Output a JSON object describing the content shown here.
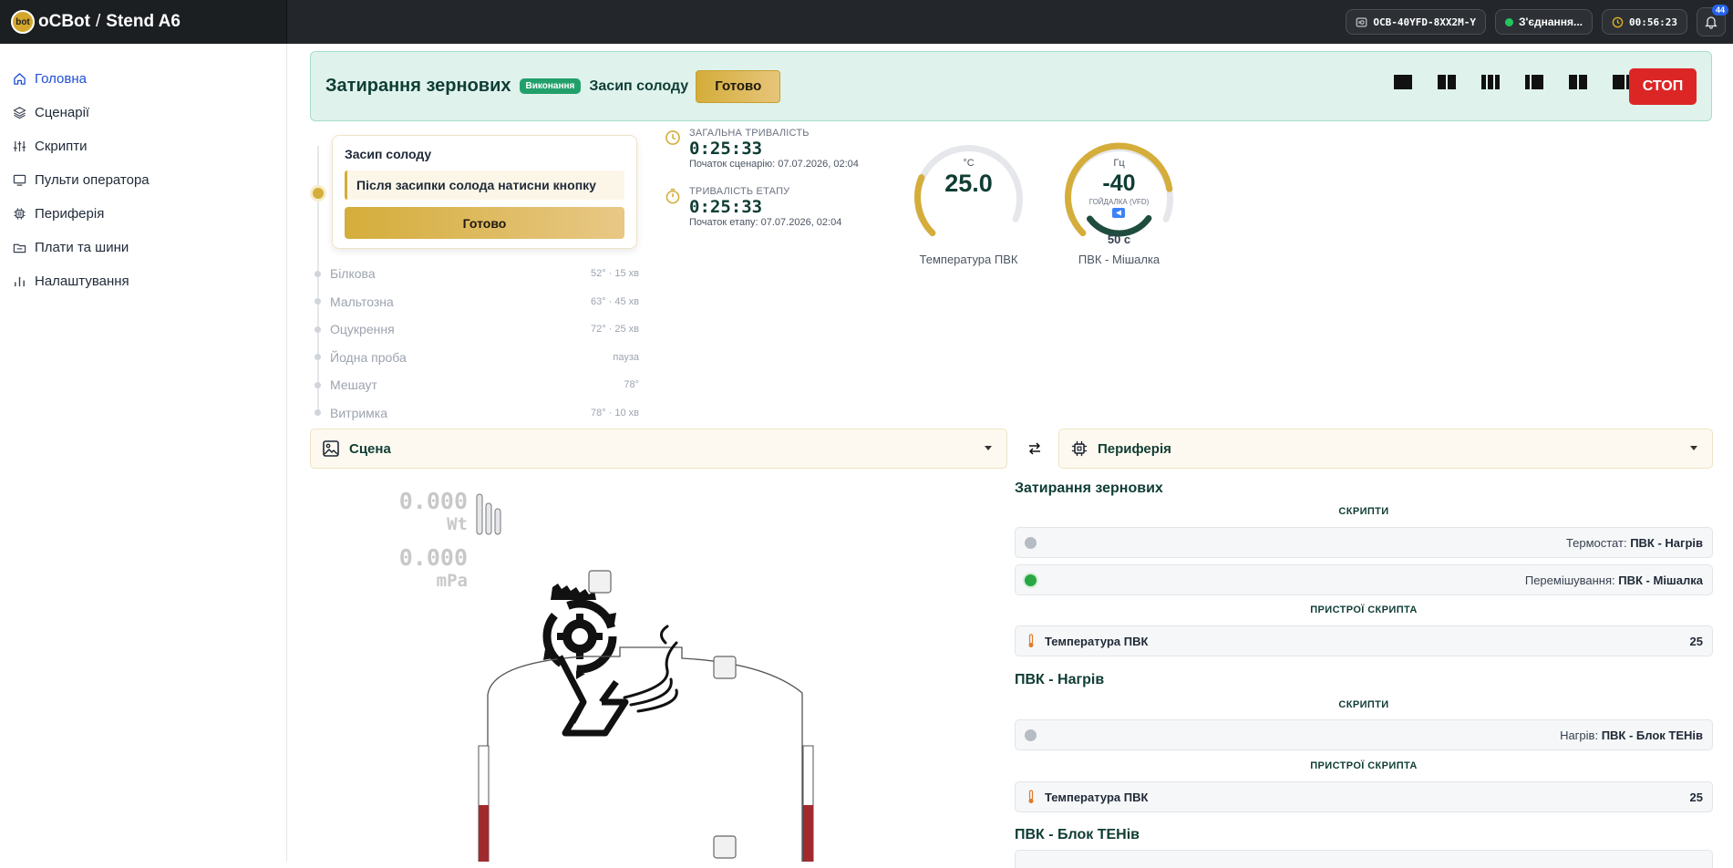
{
  "header": {
    "brand_name": "oCBot",
    "logo_text": "bot",
    "separator": "/",
    "stand": "Stend A6",
    "device_id": "OCB-40YFD-8XX2M-Y",
    "connection": "З'єднання...",
    "timer": "00:56:23",
    "notifications": "44"
  },
  "sidebar": {
    "items": [
      {
        "label": "Головна",
        "icon": "home-icon"
      },
      {
        "label": "Сценарії",
        "icon": "layers-icon"
      },
      {
        "label": "Скрипти",
        "icon": "sliders-icon"
      },
      {
        "label": "Пульти оператора",
        "icon": "monitor-icon"
      },
      {
        "label": "Периферія",
        "icon": "chip-icon"
      },
      {
        "label": "Плати та шини",
        "icon": "board-icon"
      },
      {
        "label": "Налаштування",
        "icon": "bars-icon"
      }
    ]
  },
  "banner": {
    "title": "Затирання зернових",
    "status": "Виконання",
    "step": "Засип солоду",
    "ready_label": "Готово",
    "stop_label": "СТОП"
  },
  "step_card": {
    "title": "Засип солоду",
    "message": "Після засипки солода натисни кнопку",
    "button": "Готово"
  },
  "steps": [
    {
      "name": "Білкова",
      "value": "52° · 15 хв"
    },
    {
      "name": "Мальтозна",
      "value": "63° · 45 хв"
    },
    {
      "name": "Оцукрення",
      "value": "72° · 25 хв"
    },
    {
      "name": "Йодна проба",
      "value": "пауза"
    },
    {
      "name": "Мешаут",
      "value": "78°"
    },
    {
      "name": "Витримка",
      "value": "78° · 10 хв"
    }
  ],
  "durations": {
    "total_label": "ЗАГАЛЬНА ТРИВАЛІСТЬ",
    "total_value": "0:25:33",
    "total_sub": "Початок сценарію: 07.07.2026, 02:04",
    "stage_label": "ТРИВАЛІСТЬ ЕТАПУ",
    "stage_value": "0:25:33",
    "stage_sub": "Початок етапу: 07.07.2026, 02:04"
  },
  "gauges": {
    "temp": {
      "unit": "°C",
      "value": "25.0",
      "caption": "Температура ПВК",
      "fraction": 0.25
    },
    "mixer": {
      "unit": "Гц",
      "value": "-40",
      "mode": "ГОЙДАЛКА (VFD)",
      "timer": "50 с",
      "caption": "ПВК - Мішалка",
      "fraction": 0.8,
      "timer_fraction": 0.35
    }
  },
  "panels": {
    "scene_label": "Сцена",
    "periphery_label": "Периферія"
  },
  "scene": {
    "power_value": "0.000",
    "power_unit": "Wt",
    "pressure_value": "0.000",
    "pressure_unit": "mPa"
  },
  "periphery": {
    "sections": [
      {
        "title": "Затирання зернових",
        "scripts_head": "СКРИПТИ",
        "scripts": [
          {
            "type": "Термостат:",
            "target": "ПВК - Нагрів",
            "active": false
          },
          {
            "type": "Перемішування:",
            "target": "ПВК - Мішалка",
            "active": true
          }
        ],
        "devices_head": "ПРИСТРОЇ СКРИПТА",
        "devices": [
          {
            "name": "Температура ПВК",
            "value": "25"
          }
        ]
      },
      {
        "title": "ПВК - Нагрів",
        "scripts_head": "СКРИПТИ",
        "scripts": [
          {
            "type": "Нагрів:",
            "target": "ПВК - Блок ТЕНів",
            "active": false
          }
        ],
        "devices_head": "ПРИСТРОЇ СКРИПТА",
        "devices": [
          {
            "name": "Температура ПВК",
            "value": "25"
          }
        ]
      },
      {
        "title": "ПВК - Блок ТЕНів"
      }
    ]
  },
  "colors": {
    "accent_gold": "#d4ad3a",
    "dark_green": "#0f3d34",
    "banner_bg": "#dff3ec",
    "stop_red": "#dc2626",
    "active_green": "#28a745",
    "liquid": "#a12a2e"
  }
}
